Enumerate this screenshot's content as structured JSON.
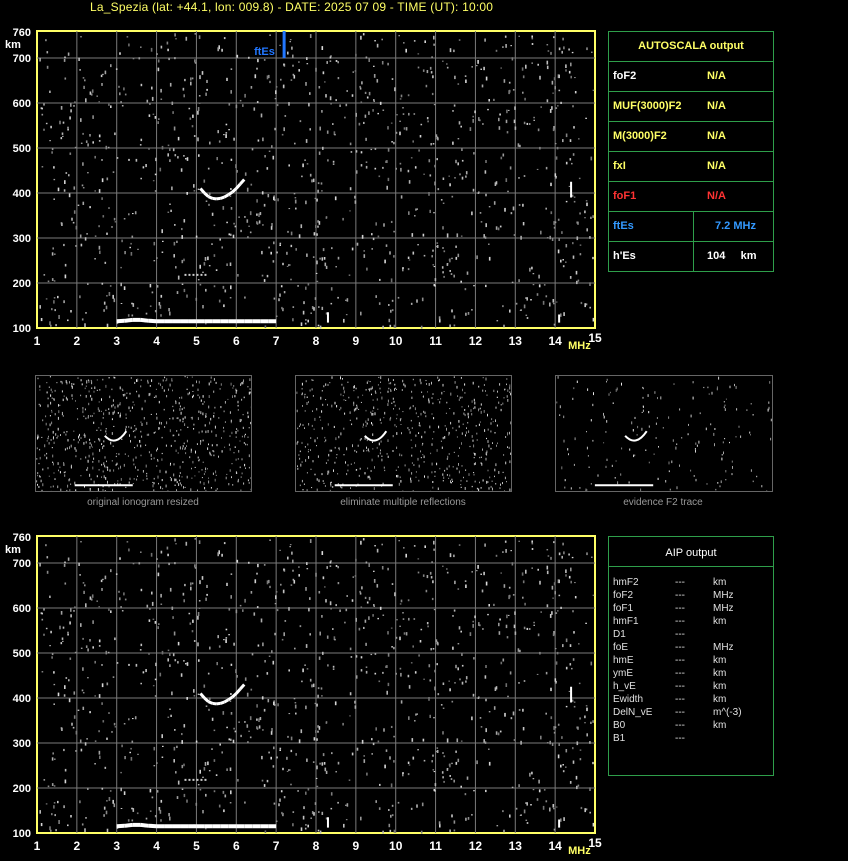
{
  "title": "La_Spezia (lat: +44.1, lon: 009.8) - DATE: 2025 07 09 - TIME (UT): 10:00",
  "chart_data": [
    {
      "type": "scatter",
      "xlabel": "MHz",
      "ylabel": "km",
      "xlim": [
        1,
        15
      ],
      "ylim": [
        100,
        760
      ],
      "x_ticks": [
        "1",
        "2",
        "3",
        "4",
        "5",
        "6",
        "7",
        "8",
        "9",
        "10",
        "11",
        "12",
        "13",
        "14",
        "15"
      ],
      "y_ticks": [
        "100",
        "200",
        "300",
        "400",
        "500",
        "600",
        "700",
        "760"
      ],
      "grid": true,
      "annotations": [
        {
          "text": "ftEs",
          "x": 7.2,
          "y": 700,
          "color": "#2277ff"
        }
      ],
      "traces": {
        "Es": [
          [
            3.0,
            115
          ],
          [
            3.2,
            116
          ],
          [
            3.4,
            118
          ],
          [
            3.6,
            118
          ],
          [
            3.8,
            116
          ],
          [
            4.0,
            115
          ],
          [
            4.2,
            115
          ],
          [
            4.4,
            115
          ],
          [
            4.6,
            115
          ],
          [
            4.8,
            115
          ],
          [
            5.0,
            115
          ],
          [
            5.2,
            115
          ],
          [
            5.4,
            115
          ],
          [
            5.6,
            115
          ],
          [
            5.8,
            115
          ],
          [
            6.0,
            115
          ],
          [
            6.2,
            115
          ],
          [
            6.4,
            115
          ],
          [
            6.6,
            115
          ],
          [
            6.8,
            115
          ],
          [
            7.0,
            115
          ]
        ],
        "F2_arc": [
          [
            5.1,
            410
          ],
          [
            5.2,
            400
          ],
          [
            5.3,
            392
          ],
          [
            5.4,
            388
          ],
          [
            5.5,
            387
          ],
          [
            5.6,
            388
          ],
          [
            5.7,
            391
          ],
          [
            5.8,
            396
          ],
          [
            5.9,
            402
          ],
          [
            6.0,
            410
          ],
          [
            6.1,
            420
          ],
          [
            6.2,
            430
          ]
        ]
      }
    },
    {
      "type": "scatter",
      "xlabel": "MHz",
      "ylabel": "km",
      "xlim": [
        1,
        15
      ],
      "ylim": [
        100,
        760
      ],
      "x_ticks": [
        "1",
        "2",
        "3",
        "4",
        "5",
        "6",
        "7",
        "8",
        "9",
        "10",
        "11",
        "12",
        "13",
        "14",
        "15"
      ],
      "y_ticks": [
        "100",
        "200",
        "300",
        "400",
        "500",
        "600",
        "700",
        "760"
      ],
      "grid": true
    }
  ],
  "autoscala": {
    "header": "AUTOSCALA output",
    "rows": [
      {
        "name": "foF2",
        "value": "N/A",
        "name_color": "#ffffff",
        "value_color": "#ffff66"
      },
      {
        "name": "MUF(3000)F2",
        "value": "N/A",
        "name_color": "#ffff66",
        "value_color": "#ffff66"
      },
      {
        "name": "M(3000)F2",
        "value": "N/A",
        "name_color": "#ffff66",
        "value_color": "#ffff66"
      },
      {
        "name": "fxI",
        "value": "N/A",
        "name_color": "#ffff66",
        "value_color": "#ffff66"
      },
      {
        "name": "foF1",
        "value": "N/A",
        "name_color": "#ff3333",
        "value_color": "#ff3333"
      },
      {
        "name": "ftEs",
        "value": "7.2 MHz",
        "name_color": "#3399ff",
        "value_color": "#3399ff"
      },
      {
        "name": "h'Es",
        "value": "104     km",
        "name_color": "#ffffff",
        "value_color": "#ffffff"
      }
    ]
  },
  "thumbnails": [
    {
      "caption": "original ionogram resized"
    },
    {
      "caption": "eliminate multiple reflections"
    },
    {
      "caption": "evidence F2 trace"
    }
  ],
  "aip": {
    "header": "AIP output",
    "rows": [
      {
        "name": "hmF2",
        "value": "---",
        "unit": "km"
      },
      {
        "name": "foF2",
        "value": "---",
        "unit": "MHz"
      },
      {
        "name": "foF1",
        "value": "---",
        "unit": "MHz"
      },
      {
        "name": "hmF1",
        "value": "---",
        "unit": "km"
      },
      {
        "name": "D1",
        "value": "---",
        "unit": ""
      },
      {
        "name": "foE",
        "value": "---",
        "unit": "MHz"
      },
      {
        "name": "hmE",
        "value": "---",
        "unit": "km"
      },
      {
        "name": "ymE",
        "value": "---",
        "unit": "km"
      },
      {
        "name": "h_vE",
        "value": "---",
        "unit": "km"
      },
      {
        "name": "Ewidth",
        "value": "---",
        "unit": "km"
      },
      {
        "name": "DelN_vE",
        "value": "---",
        "unit": "m^(-3)"
      },
      {
        "name": "B0",
        "value": "---",
        "unit": "km"
      },
      {
        "name": "B1",
        "value": "---",
        "unit": ""
      }
    ]
  },
  "colors": {
    "grid": "#808080",
    "axis": "#ffff66",
    "panel_border": "#2e9e4a",
    "ftEs": "#2277ff"
  }
}
